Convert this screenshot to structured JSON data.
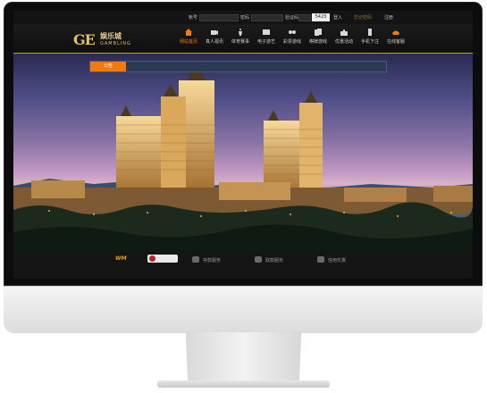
{
  "topbar": {
    "account_label": "帐号",
    "password_label": "密码",
    "code_label": "验证码",
    "captcha_value": "5423",
    "login_label": "登入",
    "forgot_label": "忘记密码",
    "register_label": "注册"
  },
  "brand": {
    "mark": "GE",
    "name_cn": "娱乐城",
    "name_en": "GAMBLING"
  },
  "nav": {
    "items": [
      {
        "label": "网站首页",
        "icon": "home-icon"
      },
      {
        "label": "真人视讯",
        "icon": "video-icon"
      },
      {
        "label": "体育赛事",
        "icon": "sports-icon"
      },
      {
        "label": "电子游艺",
        "icon": "slot-icon"
      },
      {
        "label": "彩票游戏",
        "icon": "lottery-icon"
      },
      {
        "label": "棋牌游戏",
        "icon": "cards-icon"
      },
      {
        "label": "优惠活动",
        "icon": "gift-icon"
      },
      {
        "label": "手机下注",
        "icon": "mobile-icon"
      },
      {
        "label": "在线客服",
        "icon": "phone-icon"
      }
    ],
    "active_index": 0
  },
  "notice": {
    "label": "公告",
    "text": ""
  },
  "footer": {
    "services": [
      {
        "label": "存款服务",
        "icon": "deposit-icon"
      },
      {
        "label": "取款服务",
        "icon": "withdraw-icon"
      },
      {
        "label": "信用优惠",
        "icon": "lock-icon"
      }
    ],
    "partner_label": "WM"
  },
  "colors": {
    "accent": "#f08000",
    "gold": "#e2c06a",
    "nav_bg": "#151515",
    "notice_tag": "#f07a10"
  }
}
